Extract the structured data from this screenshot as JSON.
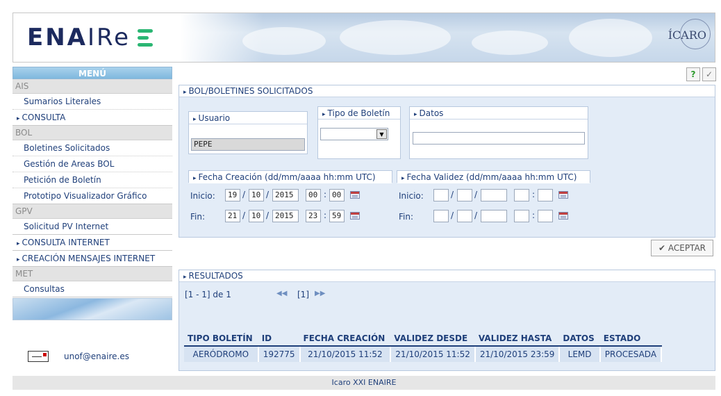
{
  "header": {
    "logo_bold": "ENA",
    "logo_thin": "IRe",
    "brand_right": "ÍCARO"
  },
  "colors": {
    "accent": "#1f3f7a",
    "logo_green": "#2bb673",
    "panel_bg": "#e3ecf7",
    "menu_title_bg": "#7fb8de"
  },
  "sidebar": {
    "title": "MENÚ",
    "sections": [
      {
        "label": "AIS",
        "items": [
          "Sumarios Literales"
        ],
        "arrow_items": [
          "CONSULTA"
        ]
      },
      {
        "label": "BOL",
        "items": [
          "Boletines Solicitados",
          "Gestión de Areas BOL",
          "Petición de Boletín",
          "Prototipo Visualizador Gráfico"
        ],
        "arrow_items": []
      },
      {
        "label": "GPV",
        "items": [
          "Solicitud PV Internet"
        ],
        "arrow_items": [
          "CONSULTA INTERNET",
          "CREACIÓN MENSAJES INTERNET"
        ]
      },
      {
        "label": "MET",
        "items": [
          "Consultas"
        ],
        "arrow_items": []
      }
    ],
    "email": "unof@enaire.es"
  },
  "toolbar": {
    "help_label": "?",
    "check_label": "✓"
  },
  "form": {
    "title": "BOL/BOLETINES SOLICITADOS",
    "usuario_label": "Usuario",
    "usuario_value": "PEPE",
    "tipo_label": "Tipo de Boletín",
    "tipo_value": "",
    "datos_label": "Datos",
    "datos_value": "",
    "fecha_creacion_label": "Fecha Creación (dd/mm/aaaa hh:mm UTC)",
    "fecha_validez_label": "Fecha Validez (dd/mm/aaaa hh:mm UTC)",
    "inicio_label": "Inicio:",
    "fin_label": "Fin:",
    "creacion_inicio": {
      "dd": "19",
      "mm": "10",
      "aaaa": "2015",
      "hh": "00",
      "min": "00"
    },
    "creacion_fin": {
      "dd": "21",
      "mm": "10",
      "aaaa": "2015",
      "hh": "23",
      "min": "59"
    },
    "validez_inicio": {
      "dd": "",
      "mm": "",
      "aaaa": "",
      "hh": "",
      "min": ""
    },
    "validez_fin": {
      "dd": "",
      "mm": "",
      "aaaa": "",
      "hh": "",
      "min": ""
    },
    "slash": "/",
    "colon": ":",
    "aceptar_label": "ACEPTAR"
  },
  "results": {
    "title": "RESULTADOS",
    "range": "[1 - 1] de 1",
    "page": "[1]",
    "prev": "◀◀",
    "next": "▶▶",
    "columns": [
      "TIPO BOLETÍN",
      "ID",
      "FECHA CREACIÓN",
      "VALIDEZ DESDE",
      "VALIDEZ HASTA",
      "DATOS",
      "ESTADO"
    ],
    "rows": [
      [
        "AERÓDROMO",
        "192775",
        "21/10/2015 11:52",
        "21/10/2015 11:52",
        "21/10/2015 23:59",
        "LEMD",
        "PROCESADA"
      ]
    ]
  },
  "footer": {
    "text": "Icaro XXI ENAIRE"
  }
}
